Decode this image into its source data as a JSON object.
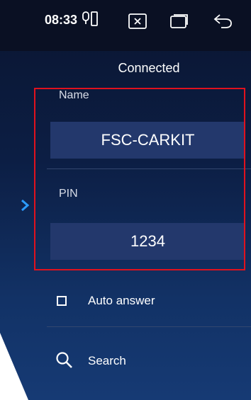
{
  "status": {
    "time": "08:33"
  },
  "header": {
    "title": "Connected"
  },
  "name_section": {
    "label": "Name",
    "value": "FSC-CARKIT"
  },
  "pin_section": {
    "label": "PIN",
    "value": "1234"
  },
  "options": {
    "auto_answer_label": "Auto answer",
    "auto_answer_checked": false,
    "search_label": "Search"
  },
  "colors": {
    "highlight_box": "#e0121e",
    "field_bg": "#23386c",
    "accent": "#2b9cff"
  }
}
